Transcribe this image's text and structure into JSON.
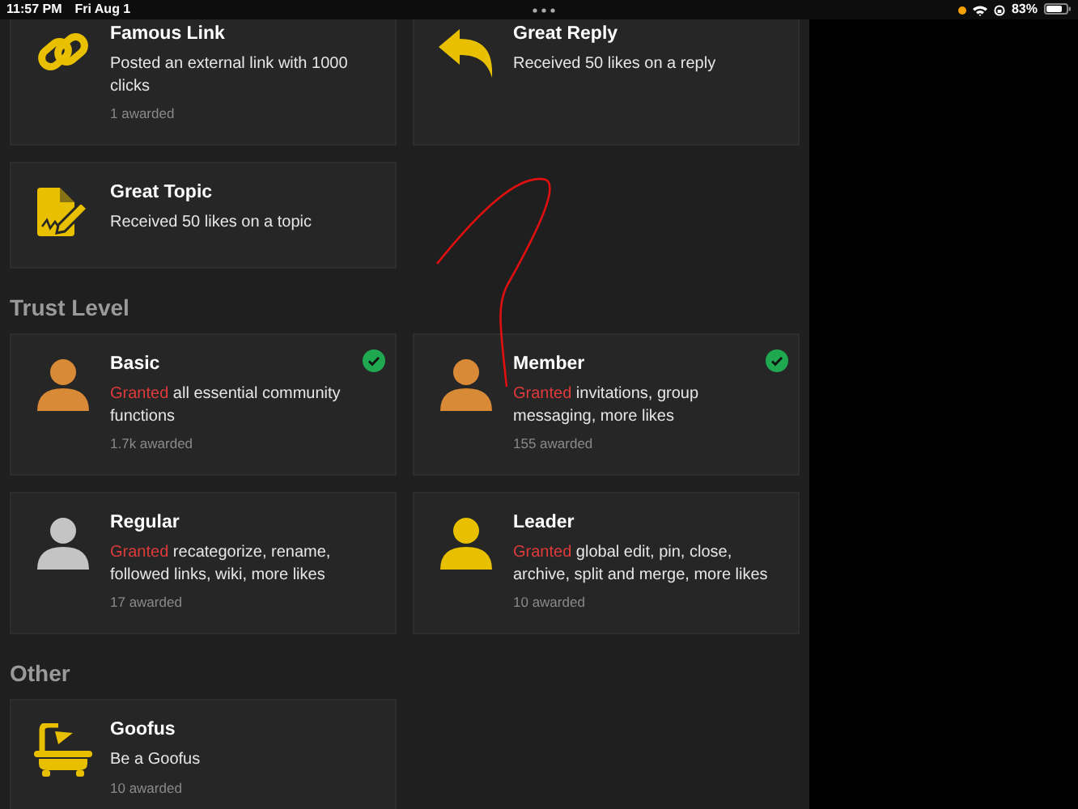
{
  "status_bar": {
    "time": "11:57 PM",
    "date": "Fri Aug 1",
    "battery": "83%"
  },
  "sections": [
    {
      "badges": [
        {
          "kind": "link",
          "title": "Famous Link",
          "description": "Posted an external link with 1000 clicks",
          "awarded": "1 awarded"
        },
        {
          "kind": "reply",
          "title": "Great Reply",
          "description": "Received 50 likes on a reply"
        },
        {
          "kind": "topic",
          "title": "Great Topic",
          "description": "Received 50 likes on a topic"
        }
      ]
    },
    {
      "heading": "Trust Level",
      "badges": [
        {
          "kind": "user",
          "color": "#d98a37",
          "title": "Basic",
          "granted": "Granted",
          "description": "all essential community functions",
          "awarded": "1.7k awarded",
          "earned": true
        },
        {
          "kind": "user",
          "color": "#d98a37",
          "title": "Member",
          "granted": "Granted",
          "description": "invitations, group messaging, more likes",
          "awarded": "155 awarded",
          "earned": true
        },
        {
          "kind": "user",
          "color": "#c4c4c4",
          "title": "Regular",
          "granted": "Granted",
          "description": "recategorize, rename, followed links, wiki, more likes",
          "awarded": "17 awarded",
          "earned": false
        },
        {
          "kind": "user",
          "color": "#e8c000",
          "title": "Leader",
          "granted": "Granted",
          "description": "global edit, pin, close, archive, split and merge, more likes",
          "awarded": "10 awarded",
          "earned": false
        }
      ]
    },
    {
      "heading": "Other",
      "badges": [
        {
          "kind": "bath",
          "title": "Goofus",
          "description": "Be a Goofus",
          "awarded": "10 awarded"
        }
      ]
    }
  ]
}
